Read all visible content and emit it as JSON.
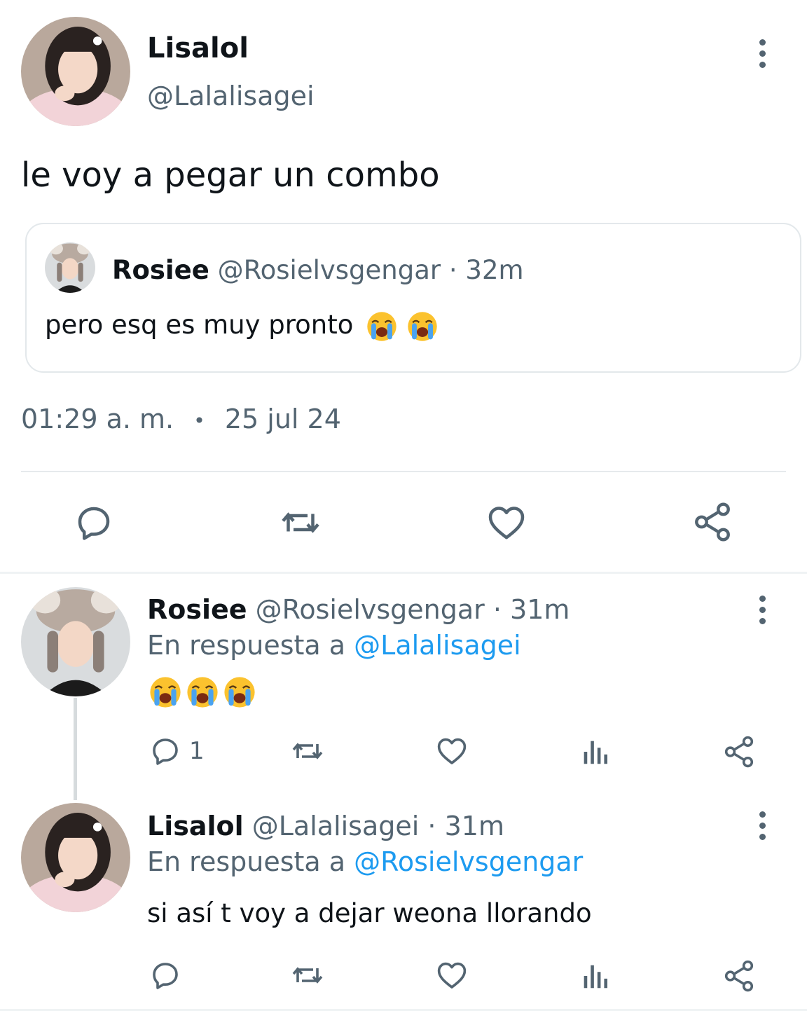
{
  "main_tweet": {
    "author_name": "Lisalol",
    "handle": "@Lalalisagei",
    "text": "le voy a pegar un combo",
    "quoted": {
      "author_name": "Rosiee",
      "handle": "@Rosielvsgengar",
      "separator": "·",
      "time": "32m",
      "text": "pero esq es muy pronto"
    },
    "time": "01:29 a. m.",
    "dot": "•",
    "date": "25 jul 24",
    "actions": [
      "reply-icon",
      "retweet-icon",
      "like-icon",
      "share-icon"
    ]
  },
  "replies": [
    {
      "author_name": "Rosiee",
      "handle": "@Rosielvsgengar",
      "separator": "·",
      "time": "31m",
      "reply_prefix": "En respuesta a",
      "reply_to": "@Lalalisagei",
      "text": "",
      "emoji_count": 3,
      "reply_count": "1"
    },
    {
      "author_name": "Lisalol",
      "handle": "@Lalalisagei",
      "separator": "·",
      "time": "31m",
      "reply_prefix": "En respuesta a",
      "reply_to": "@Rosielvsgengar",
      "text": "si así t voy a dejar weona llorando",
      "reply_count": ""
    }
  ],
  "colors": {
    "text": "#0f1419",
    "muted": "#536471",
    "link": "#1d9bf0",
    "divider": "#eff3f4"
  }
}
